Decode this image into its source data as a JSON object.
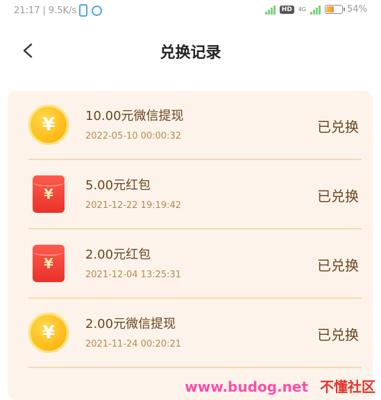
{
  "status_bar": {
    "time": "21:17",
    "speed": "9.5K/s",
    "battery_percent": "54%",
    "battery_level": 0.54,
    "hd_label": "HD",
    "network_label": "4G"
  },
  "nav": {
    "title": "兑换记录"
  },
  "records": [
    {
      "name": "10.00元微信提现",
      "time": "2022-05-10 00:00:32",
      "status": "已兑换",
      "icon": "coin-icon"
    },
    {
      "name": "5.00元红包",
      "time": "2021-12-22 19:19:42",
      "status": "已兑换",
      "icon": "red-packet-icon"
    },
    {
      "name": "2.00元红包",
      "time": "2021-12-04 13:25:31",
      "status": "已兑换",
      "icon": "red-packet-icon"
    },
    {
      "name": "2.00元微信提现",
      "time": "2021-11-24 00:20:21",
      "status": "已兑换",
      "icon": "coin-icon"
    }
  ],
  "currency_symbol": "¥",
  "watermark": {
    "url": "www.budog.net",
    "name": "不懂社区"
  },
  "colors": {
    "card_bg": "#fdf3ea",
    "divider": "#f5d9b8",
    "text_brown": "#6b4520",
    "time_text": "#b58a4e"
  }
}
